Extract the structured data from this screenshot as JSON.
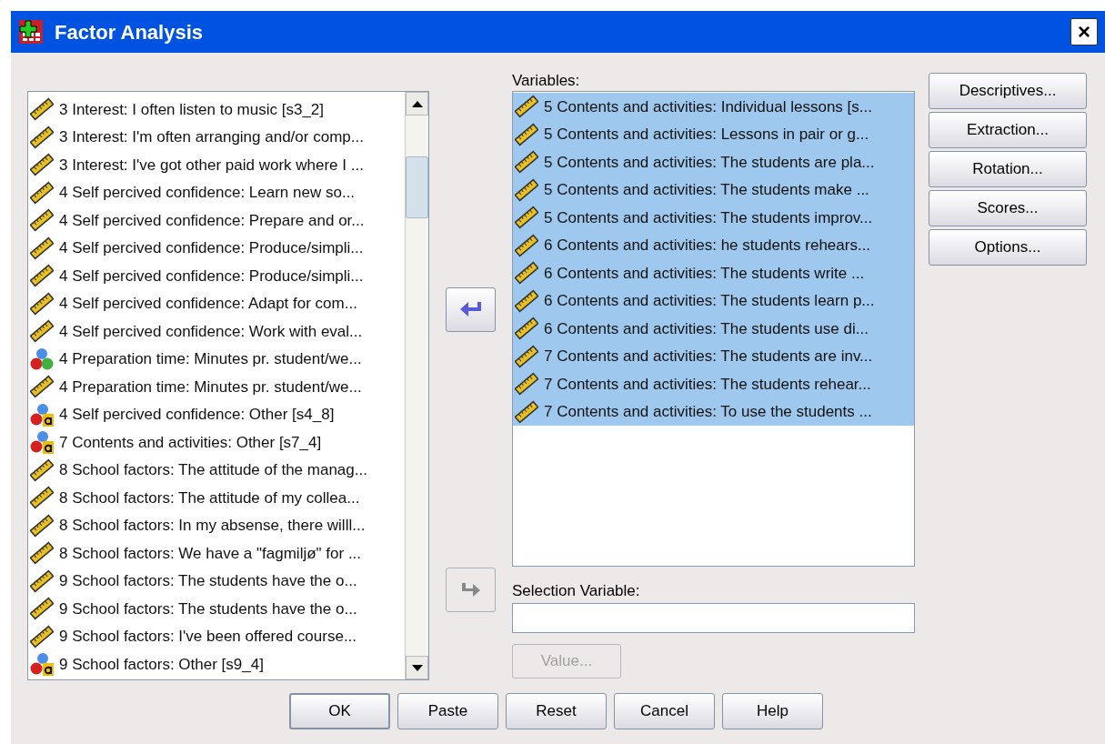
{
  "window": {
    "title": "Factor Analysis",
    "close": "×"
  },
  "source_list": {
    "items": [
      {
        "kind": "scale",
        "label": "3 Interest: I often listen to music [s3_2]"
      },
      {
        "kind": "scale",
        "label": "3 Interest: I'm often arranging and/or comp..."
      },
      {
        "kind": "scale",
        "label": "3 Interest: I've got other paid work where I ..."
      },
      {
        "kind": "scale",
        "label": "4 Self percived confidence: Learn new so..."
      },
      {
        "kind": "scale",
        "label": "4 Self percived confidence: Prepare and or..."
      },
      {
        "kind": "scale",
        "label": "4 Self percived confidence: Produce/simpli..."
      },
      {
        "kind": "scale",
        "label": "4 Self percived confidence: Produce/simpli..."
      },
      {
        "kind": "scale",
        "label": "4 Self percived confidence: Adapt for com..."
      },
      {
        "kind": "scale",
        "label": "4 Self percived confidence: Work with eval..."
      },
      {
        "kind": "nominal",
        "label": "4 Preparation time: Minutes pr. student/we..."
      },
      {
        "kind": "scale",
        "label": "4 Preparation time: Minutes pr. student/we..."
      },
      {
        "kind": "string",
        "label": "4 Self percived confidence: Other [s4_8]"
      },
      {
        "kind": "string",
        "label": "7 Contents and activities: Other [s7_4]"
      },
      {
        "kind": "scale",
        "label": "8 School factors: The attitude of the manag..."
      },
      {
        "kind": "scale",
        "label": "8 School factors: The attitude of my collea..."
      },
      {
        "kind": "scale",
        "label": "8 School factors: In my absense, there willl..."
      },
      {
        "kind": "scale",
        "label": "8 School factors: We have a \"fagmiljø\" for ..."
      },
      {
        "kind": "scale",
        "label": "9 School factors: The students have the o..."
      },
      {
        "kind": "scale",
        "label": "9 School factors: The students have the o..."
      },
      {
        "kind": "scale",
        "label": "9 School factors: I've been offered course..."
      },
      {
        "kind": "string",
        "label": "9 School factors: Other [s9_4]"
      }
    ]
  },
  "variables": {
    "label": "Variables:",
    "items": [
      {
        "kind": "scale",
        "selected": true,
        "label": "5 Contents and activities: Individual lessons [s..."
      },
      {
        "kind": "scale",
        "selected": true,
        "label": "5 Contents and activities: Lessons in pair or g..."
      },
      {
        "kind": "scale",
        "selected": true,
        "label": "5 Contents and activities: The students are pla..."
      },
      {
        "kind": "scale",
        "selected": true,
        "label": "5 Contents and activities: The students make ..."
      },
      {
        "kind": "scale",
        "selected": true,
        "label": "5 Contents and activities: The students improv..."
      },
      {
        "kind": "scale",
        "selected": true,
        "label": "6 Contents and activities: he students rehears..."
      },
      {
        "kind": "scale",
        "selected": true,
        "label": "6 Contents and activities: The students write ..."
      },
      {
        "kind": "scale",
        "selected": true,
        "label": "6 Contents and activities: The students learn p..."
      },
      {
        "kind": "scale",
        "selected": true,
        "label": "6 Contents and activities: The students use di..."
      },
      {
        "kind": "scale",
        "selected": true,
        "label": "7 Contents and activities: The students are inv..."
      },
      {
        "kind": "scale",
        "selected": true,
        "label": "7 Contents and activities: The students rehear..."
      },
      {
        "kind": "scale",
        "selected": true,
        "label": "7 Contents and activities: To use the students ..."
      }
    ]
  },
  "side_buttons": [
    "Descriptives...",
    "Extraction...",
    "Rotation...",
    "Scores...",
    "Options..."
  ],
  "selection_variable": {
    "label": "Selection Variable:",
    "value_button": {
      "label": "Value...",
      "disabled": true
    },
    "move_button": {
      "disabled": true
    }
  },
  "move_button": {
    "disabled": false
  },
  "buttons": [
    {
      "label": "OK",
      "default": true
    },
    {
      "label": "Paste",
      "default": false
    },
    {
      "label": "Reset",
      "default": false
    },
    {
      "label": "Cancel",
      "default": false
    },
    {
      "label": "Help",
      "default": false
    }
  ]
}
